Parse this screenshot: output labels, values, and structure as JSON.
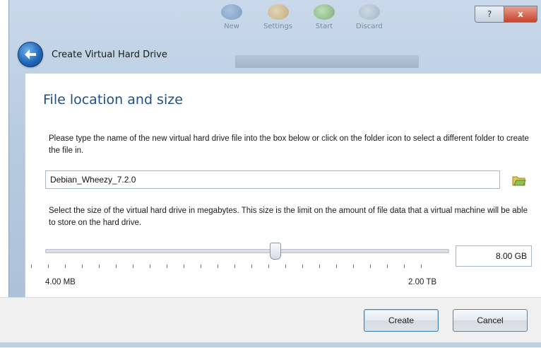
{
  "window": {
    "title": "Create Virtual Hard Drive",
    "controls": {
      "help_label": "?",
      "close_label": "x"
    }
  },
  "background": {
    "toolbar_items": [
      "New",
      "Settings",
      "Start",
      "Discard"
    ]
  },
  "page": {
    "heading": "File location and size",
    "location_description": "Please type the name of the new virtual hard drive file into the box below or click on the folder icon to select a different folder to create the file in.",
    "filename_value": "Debian_Wheezy_7.2.0",
    "size_description": "Select the size of the virtual hard drive in megabytes. This size is the limit on the amount of file data that a virtual machine will be able to store on the hard drive.",
    "size_value": "8.00 GB",
    "slider_min_label": "4.00 MB",
    "slider_max_label": "2.00 TB"
  },
  "footer": {
    "create_label": "Create",
    "cancel_label": "Cancel"
  },
  "colors": {
    "heading": "#1e4f86",
    "accent": "#3c7fb1",
    "close": "#c7432c"
  }
}
